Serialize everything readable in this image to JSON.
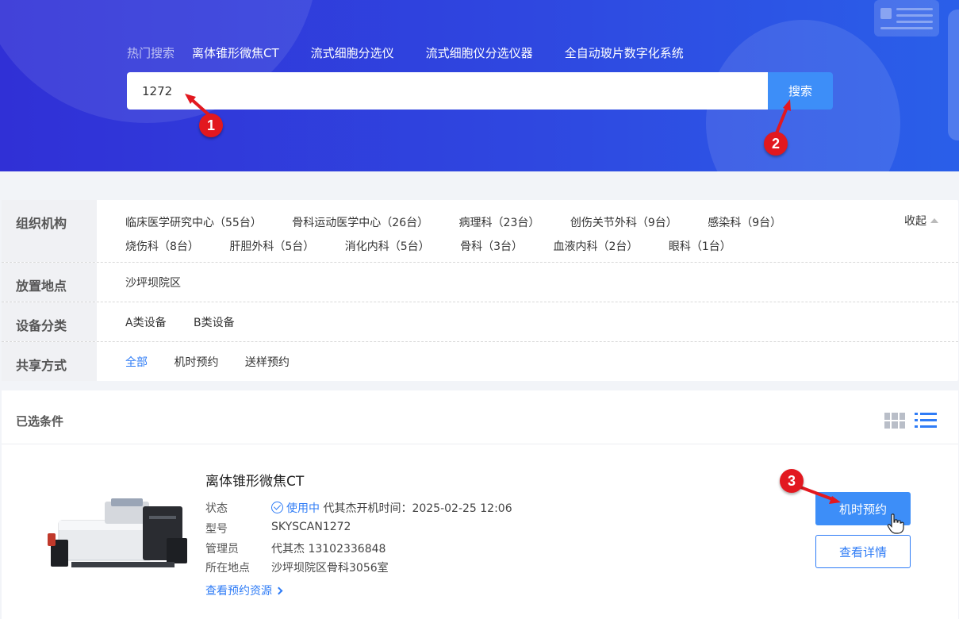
{
  "hot_search": {
    "label": "热门搜索",
    "keywords": [
      "离体锥形微焦CT",
      "流式细胞分选仪",
      "流式细胞仪分选仪器",
      "全自动玻片数字化系统"
    ]
  },
  "search": {
    "value": "1272",
    "button_label": "搜索"
  },
  "steps": [
    "1",
    "2",
    "3"
  ],
  "filters": {
    "org": {
      "label": "组织机构",
      "options": [
        "临床医学研究中心（55台）",
        "骨科运动医学中心（26台）",
        "病理科（23台）",
        "创伤关节外科（9台）",
        "感染科（9台）",
        "烧伤科（8台）",
        "肝胆外科（5台）",
        "消化内科（5台）",
        "骨科（3台）",
        "血液内科（2台）",
        "眼科（1台）"
      ],
      "collapse_label": "收起"
    },
    "location": {
      "label": "放置地点",
      "options": [
        "沙坪坝院区"
      ]
    },
    "category": {
      "label": "设备分类",
      "options": [
        "A类设备",
        "B类设备"
      ]
    },
    "share": {
      "label": "共享方式",
      "options": [
        "全部",
        "机时预约",
        "送样预约"
      ],
      "active": "全部"
    }
  },
  "results": {
    "header": "已选条件",
    "item": {
      "title": "离体锥形微焦CT",
      "status_label": "状态",
      "status_value": "使用中",
      "status_extra": "代其杰开机时间：2025-02-25 12:06",
      "model_label": "型号",
      "model_value": "SKYSCAN1272",
      "admin_label": "管理员",
      "admin_value": "代其杰 13102336848",
      "place_label": "所在地点",
      "place_value": "沙坪坝院区骨科3056室",
      "link_label": "查看预约资源",
      "book_label": "机时预约",
      "detail_label": "查看详情"
    }
  },
  "colors": {
    "primary": "#3d8ef8",
    "link": "#2f7cf6",
    "badge": "#e2181f"
  }
}
